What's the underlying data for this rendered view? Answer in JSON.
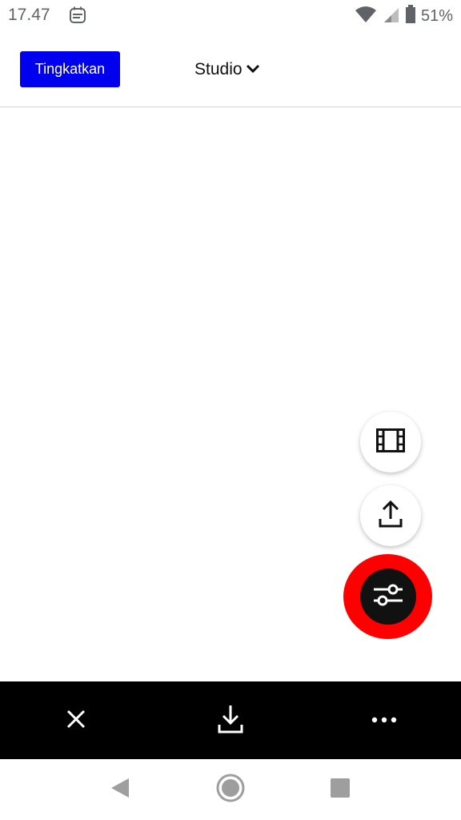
{
  "status_bar": {
    "time": "17.47",
    "battery": "51%",
    "icons": [
      "notification-app-icon",
      "wifi-icon",
      "signal-icon",
      "battery-icon"
    ]
  },
  "header": {
    "upgrade_label": "Tingkatkan",
    "studio_label": "Studio",
    "icons": [
      "chevron-down-icon"
    ]
  },
  "fabs": {
    "icons": [
      "film-icon",
      "share-icon",
      "sliders-icon"
    ]
  },
  "bottom_toolbar": {
    "icons": [
      "close-icon",
      "download-icon",
      "more-icon"
    ]
  },
  "nav_bar": {
    "icons": [
      "back-icon",
      "home-icon",
      "recents-icon"
    ]
  },
  "colors": {
    "upgrade_bg": "#0000ee",
    "fab_ring": "#ff0000",
    "toolbar_bg": "#000000"
  }
}
